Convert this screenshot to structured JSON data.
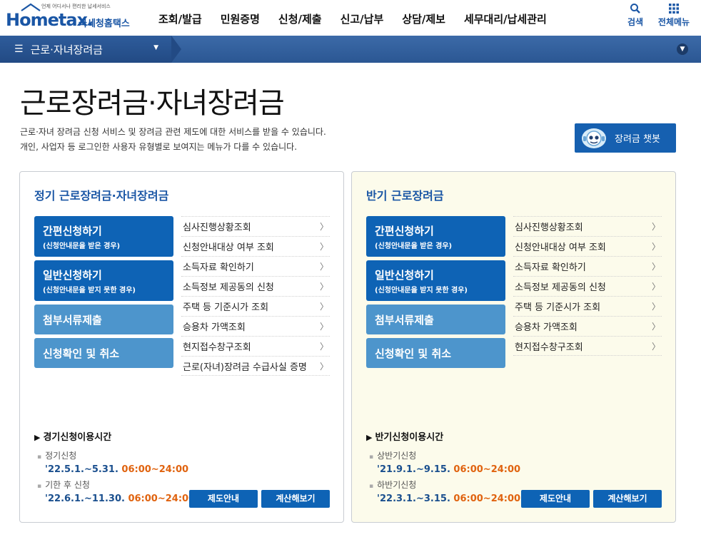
{
  "header": {
    "logo_tagline": "언제 어디서나 편리한 납세서비스",
    "logo_brand": "Hometax.",
    "logo_sub": "국세청홈택스",
    "menu": [
      "조회/발급",
      "민원증명",
      "신청/제출",
      "신고/납부",
      "상담/제보",
      "세무대리/납세관리"
    ],
    "search_label": "검색",
    "allmenu_label": "전체메뉴"
  },
  "navbar": {
    "current": "근로·자녀장려금"
  },
  "page": {
    "title": "근로장려금·자녀장려금",
    "desc1": "근로·자녀 장려금 신청 서비스 및 장려금 관련 제도에 대한 서비스를 받을 수 있습니다.",
    "desc2": "개인, 사업자 등 로그인한 사용자 유형별로 보여지는 메뉴가 다를 수 있습니다.",
    "chatbot_label": "장려금 챗봇"
  },
  "left": {
    "title": "정기 근로장려금·자녀장려금",
    "btn1_main": "간편신청하기",
    "btn1_sub": "(신청안내문을 받은 경우)",
    "btn2_main": "일반신청하기",
    "btn2_sub": "(신청안내문을 받지 못한 경우)",
    "btn3": "첨부서류제출",
    "btn4": "신청확인 및 취소",
    "links": [
      "심사진행상황조회",
      "신청안내대상 여부 조회",
      "소득자료 확인하기",
      "소득정보 제공동의 신청",
      "주택 등 기준시가 조회",
      "승용차 가액조회",
      "현지접수창구조회",
      "근로(자녀)장려금 수급사실 증명"
    ],
    "usetime": "경기신청이용시간",
    "slot1_label": "정기신청",
    "slot1_date": "'22.5.1.~5.31.",
    "slot1_time": "06:00~24:00",
    "slot2_label": "기한 후 신청",
    "slot2_date": "'22.6.1.~11.30.",
    "slot2_time": "06:00~24:00",
    "guide": "제도안내",
    "calc": "계산해보기"
  },
  "right": {
    "title": "반기 근로장려금",
    "btn1_main": "간편신청하기",
    "btn1_sub": "(신청안내문을 받은 경우)",
    "btn2_main": "일반신청하기",
    "btn2_sub": "(신청안내문을 받지 못한 경우)",
    "btn3": "첨부서류제출",
    "btn4": "신청확인 및 취소",
    "links": [
      "심사진행상황조회",
      "신청안내대상 여부 조회",
      "소득자료 확인하기",
      "소득정보 제공동의 신청",
      "주택 등 기준시가 조회",
      "승용차 가액조회",
      "현지접수창구조회"
    ],
    "usetime": "반기신청이용시간",
    "slot1_label": "상반기신청",
    "slot1_date": "'21.9.1.~9.15.",
    "slot1_time": "06:00~24:00",
    "slot2_label": "하반기신청",
    "slot2_date": "'22.3.1.~3.15.",
    "slot2_time": "06:00~24:00",
    "guide": "제도안내",
    "calc": "계산해보기"
  },
  "icons": {
    "search": "search-icon",
    "allmenu": "grid-icon",
    "hamburger": "hamburger-icon",
    "chevron": "chevron-right-icon",
    "chatbot": "robot-icon"
  },
  "colors": {
    "brand_blue": "#1a56a5",
    "button_dark": "#0e63b5",
    "button_light": "#4d95cc",
    "time_orange": "#e0630f",
    "right_panel_bg": "#fcfbeb"
  }
}
